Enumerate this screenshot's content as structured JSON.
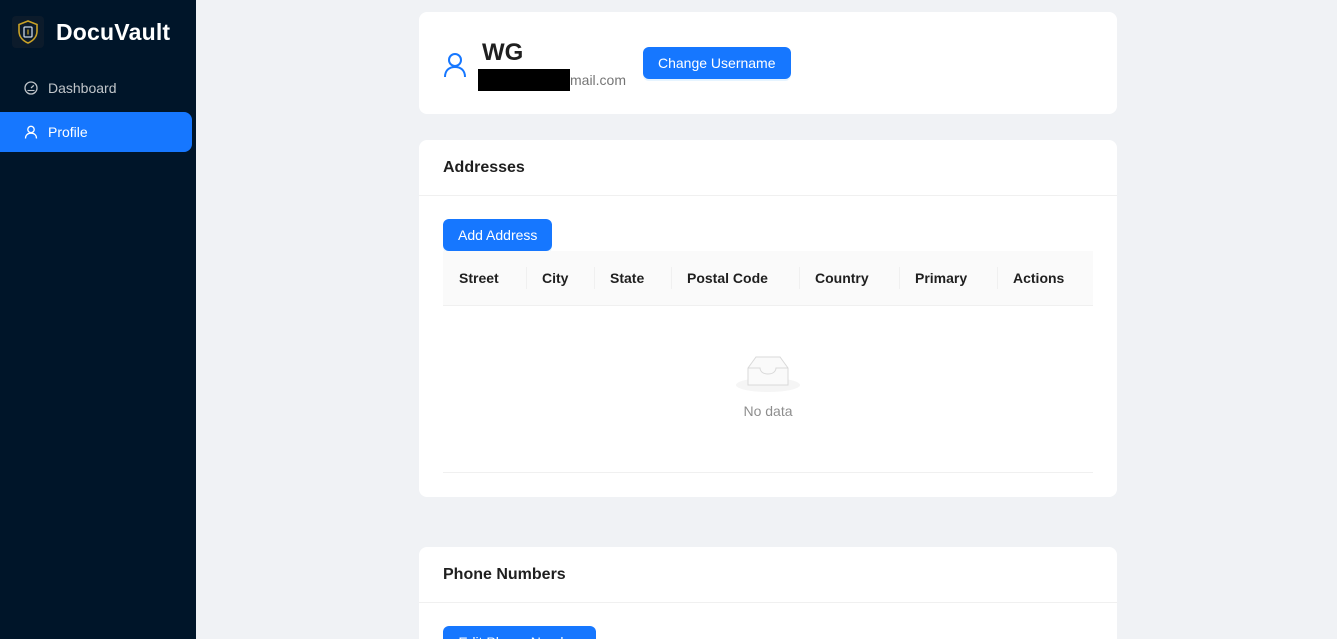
{
  "app": {
    "name": "DocuVault"
  },
  "sidebar": {
    "items": [
      {
        "label": "Dashboard",
        "icon": "dashboard-icon",
        "active": false
      },
      {
        "label": "Profile",
        "icon": "user-icon",
        "active": true
      }
    ]
  },
  "profile": {
    "username": "WG",
    "email_visible": "mail.com",
    "change_username_label": "Change Username"
  },
  "addresses": {
    "title": "Addresses",
    "add_label": "Add Address",
    "columns": [
      "Street",
      "City",
      "State",
      "Postal Code",
      "Country",
      "Primary",
      "Actions"
    ],
    "empty_text": "No data"
  },
  "phones": {
    "title": "Phone Numbers",
    "add_label": "Edit Phone Number"
  },
  "colors": {
    "sidebar_bg": "#001529",
    "accent": "#1677ff",
    "page_bg": "#f0f2f5"
  }
}
